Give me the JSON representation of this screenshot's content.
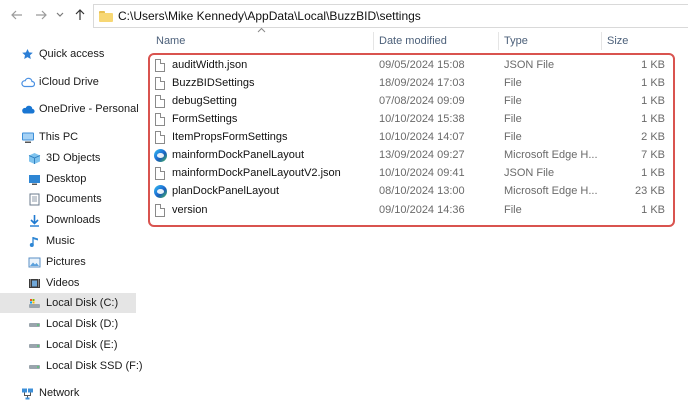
{
  "toolbar": {
    "back_icon": "arrow-left-icon",
    "forward_icon": "arrow-right-icon",
    "recent_icon": "chevron-down-icon",
    "up_icon": "arrow-up-icon",
    "address_path": "C:\\Users\\Mike Kennedy\\AppData\\Local\\BuzzBID\\settings"
  },
  "sidebar": {
    "items": [
      {
        "label": "Quick access",
        "icon": "star-icon"
      },
      {
        "label": "iCloud Drive",
        "icon": "cloud-icon"
      },
      {
        "label": "OneDrive - Personal",
        "icon": "onedrive-cloud-icon"
      },
      {
        "label": "This PC",
        "icon": "computer-icon"
      },
      {
        "label": "3D Objects",
        "icon": "cube-icon"
      },
      {
        "label": "Desktop",
        "icon": "desktop-icon"
      },
      {
        "label": "Documents",
        "icon": "documents-icon"
      },
      {
        "label": "Downloads",
        "icon": "download-icon"
      },
      {
        "label": "Music",
        "icon": "music-icon"
      },
      {
        "label": "Pictures",
        "icon": "pictures-icon"
      },
      {
        "label": "Videos",
        "icon": "video-icon"
      },
      {
        "label": "Local Disk (C:)",
        "icon": "drive-icon",
        "selected": true
      },
      {
        "label": "Local Disk (D:)",
        "icon": "drive-icon"
      },
      {
        "label": "Local Disk (E:)",
        "icon": "drive-icon"
      },
      {
        "label": "Local Disk SSD (F:)",
        "icon": "drive-icon"
      },
      {
        "label": "Network",
        "icon": "network-icon"
      }
    ]
  },
  "columns": {
    "name": "Name",
    "date": "Date modified",
    "type": "Type",
    "size": "Size"
  },
  "files": [
    {
      "name": "auditWidth.json",
      "date": "09/05/2024 15:08",
      "type": "JSON File",
      "size": "1 KB",
      "icon": "file-icon"
    },
    {
      "name": "BuzzBIDSettings",
      "date": "18/09/2024 17:03",
      "type": "File",
      "size": "1 KB",
      "icon": "file-icon"
    },
    {
      "name": "debugSetting",
      "date": "07/08/2024 09:09",
      "type": "File",
      "size": "1 KB",
      "icon": "file-icon"
    },
    {
      "name": "FormSettings",
      "date": "10/10/2024 15:38",
      "type": "File",
      "size": "1 KB",
      "icon": "file-icon"
    },
    {
      "name": "ItemPropsFormSettings",
      "date": "10/10/2024 14:07",
      "type": "File",
      "size": "2 KB",
      "icon": "file-icon"
    },
    {
      "name": "mainformDockPanelLayout",
      "date": "13/09/2024 09:27",
      "type": "Microsoft Edge H...",
      "size": "7 KB",
      "icon": "edge-icon"
    },
    {
      "name": "mainformDockPanelLayoutV2.json",
      "date": "10/10/2024 09:41",
      "type": "JSON File",
      "size": "1 KB",
      "icon": "file-icon"
    },
    {
      "name": "planDockPanelLayout",
      "date": "08/10/2024 13:00",
      "type": "Microsoft Edge H...",
      "size": "23 KB",
      "icon": "edge-icon"
    },
    {
      "name": "version",
      "date": "09/10/2024 14:36",
      "type": "File",
      "size": "1 KB",
      "icon": "file-icon"
    }
  ],
  "colors": {
    "highlight_border": "#d9534f",
    "selected_nav": "#e5e5e5",
    "header_text": "#4c607a"
  }
}
